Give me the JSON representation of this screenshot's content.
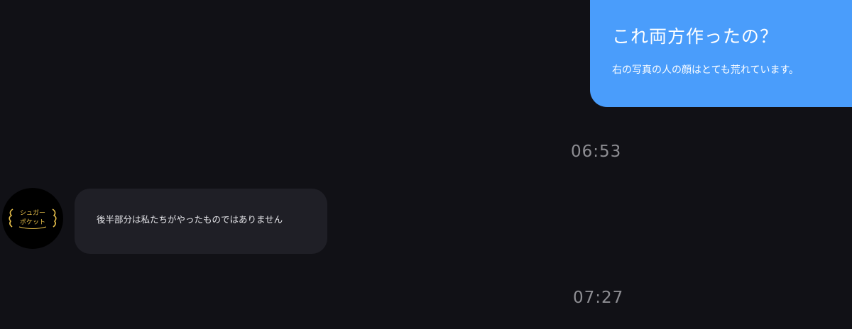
{
  "conversation": {
    "outgoing_message": {
      "headline": "これ両方作ったの？",
      "subline": "右の写真の人の顔はとても荒れています。"
    },
    "timestamps": [
      "06:53",
      "07:27"
    ],
    "incoming_message": {
      "sender_avatar_text_line1": "シュガー",
      "sender_avatar_text_line2": "ポケット",
      "text": "後半部分は私たちがやったものではありません"
    }
  },
  "colors": {
    "background": "#111116",
    "outgoing_bubble": "#4a9dfb",
    "incoming_bubble": "#1f1f26",
    "timestamp_text": "#8e8e93",
    "avatar_accent": "#e8c04a"
  }
}
